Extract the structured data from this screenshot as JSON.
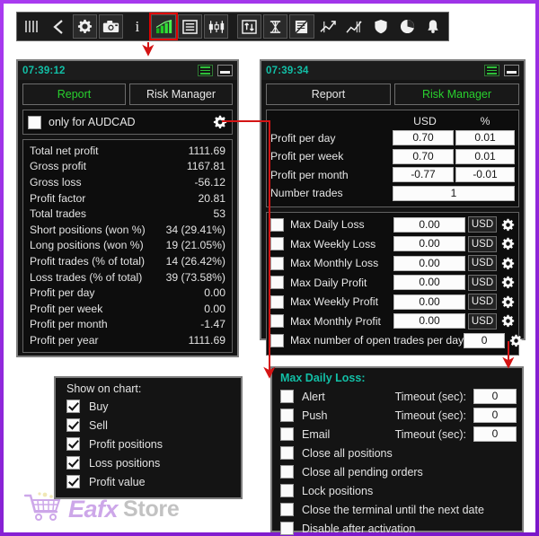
{
  "toolbar": {
    "items": [
      {
        "name": "bars-icon",
        "label": "||||"
      },
      {
        "name": "chevron-left-icon",
        "label": "<"
      },
      {
        "name": "gear-icon",
        "label": "gear"
      },
      {
        "name": "camera-icon",
        "label": "camera"
      },
      {
        "name": "info-icon",
        "label": "i"
      },
      {
        "name": "bar-chart-icon",
        "label": "bar-chart",
        "selected": true
      },
      {
        "name": "list-icon",
        "label": "list"
      },
      {
        "name": "candles-icon",
        "label": "candles"
      },
      {
        "name": "swap-icon",
        "label": "swap"
      },
      {
        "name": "timeframe-icon",
        "label": "timeframe"
      },
      {
        "name": "news-icon",
        "label": "news"
      },
      {
        "name": "trend-up-icon",
        "label": "trend-up"
      },
      {
        "name": "line-chart-icon",
        "label": "line-chart"
      },
      {
        "name": "shield-icon",
        "label": "shield"
      },
      {
        "name": "pie-chart-icon",
        "label": "pie-chart"
      },
      {
        "name": "bell-icon",
        "label": "bell"
      }
    ]
  },
  "report_panel": {
    "clock": "07:39:12",
    "tabs": [
      {
        "label": "Report",
        "active": true
      },
      {
        "label": "Risk Manager",
        "active": false
      }
    ],
    "filter": {
      "label": "only for AUDCAD",
      "checked": false,
      "gear": "gear-icon"
    },
    "rows": [
      {
        "key": "Total net profit",
        "value": "1111.69"
      },
      {
        "key": "Gross profit",
        "value": "1167.81"
      },
      {
        "key": "Gross loss",
        "value": "-56.12"
      },
      {
        "key": "Profit factor",
        "value": "20.81"
      },
      {
        "key": "Total trades",
        "value": "53"
      },
      {
        "key": "Short positions (won %)",
        "value": "34 (29.41%)"
      },
      {
        "key": "Long positions (won %)",
        "value": "19 (21.05%)"
      },
      {
        "key": "Profit trades (% of total)",
        "value": "14 (26.42%)"
      },
      {
        "key": "Loss trades (% of total)",
        "value": "39 (73.58%)"
      },
      {
        "key": "Profit per day",
        "value": "0.00"
      },
      {
        "key": "Profit per week",
        "value": "0.00"
      },
      {
        "key": "Profit per month",
        "value": "-1.47"
      },
      {
        "key": "Profit per year",
        "value": "1111.69"
      }
    ]
  },
  "risk_panel": {
    "clock": "07:39:34",
    "tabs": [
      {
        "label": "Report",
        "active": false
      },
      {
        "label": "Risk Manager",
        "active": true
      }
    ],
    "profit_table": {
      "headers": [
        "USD",
        "%"
      ],
      "rows": [
        {
          "key": "Profit per day",
          "usd": "0.70",
          "pct": "0.01"
        },
        {
          "key": "Profit per week",
          "usd": "0.70",
          "pct": "0.01"
        },
        {
          "key": "Profit per month",
          "usd": "-0.77",
          "pct": "-0.01"
        }
      ],
      "trades_row": {
        "key": "Number trades",
        "value": "1"
      }
    },
    "limits": [
      {
        "label": "Max Daily Loss",
        "value": "0.00",
        "unit": "USD",
        "checked": false
      },
      {
        "label": "Max Weekly Loss",
        "value": "0.00",
        "unit": "USD",
        "checked": false
      },
      {
        "label": "Max Monthly Loss",
        "value": "0.00",
        "unit": "USD",
        "checked": false
      },
      {
        "label": "Max Daily Profit",
        "value": "0.00",
        "unit": "USD",
        "checked": false
      },
      {
        "label": "Max Weekly Profit",
        "value": "0.00",
        "unit": "USD",
        "checked": false
      },
      {
        "label": "Max Monthly Profit",
        "value": "0.00",
        "unit": "USD",
        "checked": false
      }
    ],
    "open_trades": {
      "label": "Max number of open trades per day",
      "value": "0",
      "checked": false
    }
  },
  "show_on_chart": {
    "title": "Show on chart:",
    "options": [
      {
        "label": "Buy",
        "checked": true
      },
      {
        "label": "Sell",
        "checked": true
      },
      {
        "label": "Profit positions",
        "checked": true
      },
      {
        "label": "Loss positions",
        "checked": true
      },
      {
        "label": "Profit value",
        "checked": true
      }
    ]
  },
  "max_daily_loss": {
    "title": "Max Daily Loss:",
    "timeout_label": "Timeout (sec):",
    "rows": [
      {
        "label": "Alert",
        "checked": false,
        "timeout": "0"
      },
      {
        "label": "Push",
        "checked": false,
        "timeout": "0"
      },
      {
        "label": "Email",
        "checked": false,
        "timeout": "0"
      },
      {
        "label": "Close all positions",
        "checked": false
      },
      {
        "label": "Close all pending orders",
        "checked": false
      },
      {
        "label": "Lock positions",
        "checked": false
      },
      {
        "label": "Close the terminal until the next date",
        "checked": false
      },
      {
        "label": "Disable after activation",
        "checked": false
      }
    ]
  },
  "watermark": {
    "part1": "Eafx",
    "part2": "Store",
    "icon": "shopping-cart-icon"
  },
  "colors": {
    "accent_green": "#29d12e",
    "accent_teal": "#12bfa6",
    "arrow_red": "#d41414",
    "border_purple": "#8b1fd4"
  }
}
